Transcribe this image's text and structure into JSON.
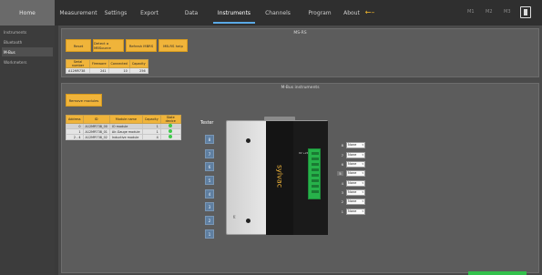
{
  "topbar": {
    "home": "Home",
    "tabs": [
      "Measurement",
      "Settings",
      "Export",
      "Data",
      "Instruments",
      "Channels",
      "Program",
      "About"
    ],
    "active_tab": "Instruments",
    "back_icon": "back-arrow-icon",
    "m_items": [
      "M1",
      "M2",
      "M3"
    ],
    "exit_icon": "exit-icon",
    "accent_color": "#f0b43a",
    "active_underline_color": "#5aa9e6"
  },
  "sidebar": {
    "items": [
      "Instruments",
      "Bluetooth",
      "M-Bus",
      "Workmeters"
    ],
    "active": "M-Bus"
  },
  "ms_panel": {
    "title": "MS-RS",
    "buttons": [
      "Reset",
      "Detect a MBSource",
      "Refresh MBRS",
      "MB-RS help"
    ],
    "table": {
      "headers": [
        "Serial number",
        "Firmware",
        "Connected",
        "Capacity"
      ],
      "rows": [
        [
          "A12MR738",
          "241",
          "10",
          "256"
        ]
      ]
    }
  },
  "mbus_panel": {
    "title": "M-Bus instruments",
    "remove_button": "Remove modules",
    "table": {
      "headers": [
        "Address",
        "ID",
        "Module name",
        "Capacity",
        "State device"
      ],
      "rows": [
        [
          "0",
          "A12MR738_00",
          "IO module",
          "1",
          "green"
        ],
        [
          "1",
          "A12MR738_01",
          "Air-Gauge module",
          "1",
          "green"
        ],
        [
          "2 - 4",
          "A12MR738_02",
          "Inductive module",
          "4",
          "green"
        ]
      ]
    },
    "tester_label": "Tester",
    "slots": [
      "8",
      "7",
      "6",
      "5",
      "4",
      "3",
      "2",
      "1"
    ],
    "device_brand": "sylvac",
    "device_model_label": "PI",
    "connector_label": "0V +24V",
    "channels": [
      {
        "num": "8",
        "value": "None"
      },
      {
        "num": "7",
        "value": "None"
      },
      {
        "num": "6",
        "value": "None"
      },
      {
        "num": "5",
        "value": "None"
      },
      {
        "num": "4",
        "value": "None"
      },
      {
        "num": "3",
        "value": "None"
      },
      {
        "num": "2",
        "value": "None"
      },
      {
        "num": "1",
        "value": "None"
      }
    ],
    "highlighted_channel": "5"
  }
}
